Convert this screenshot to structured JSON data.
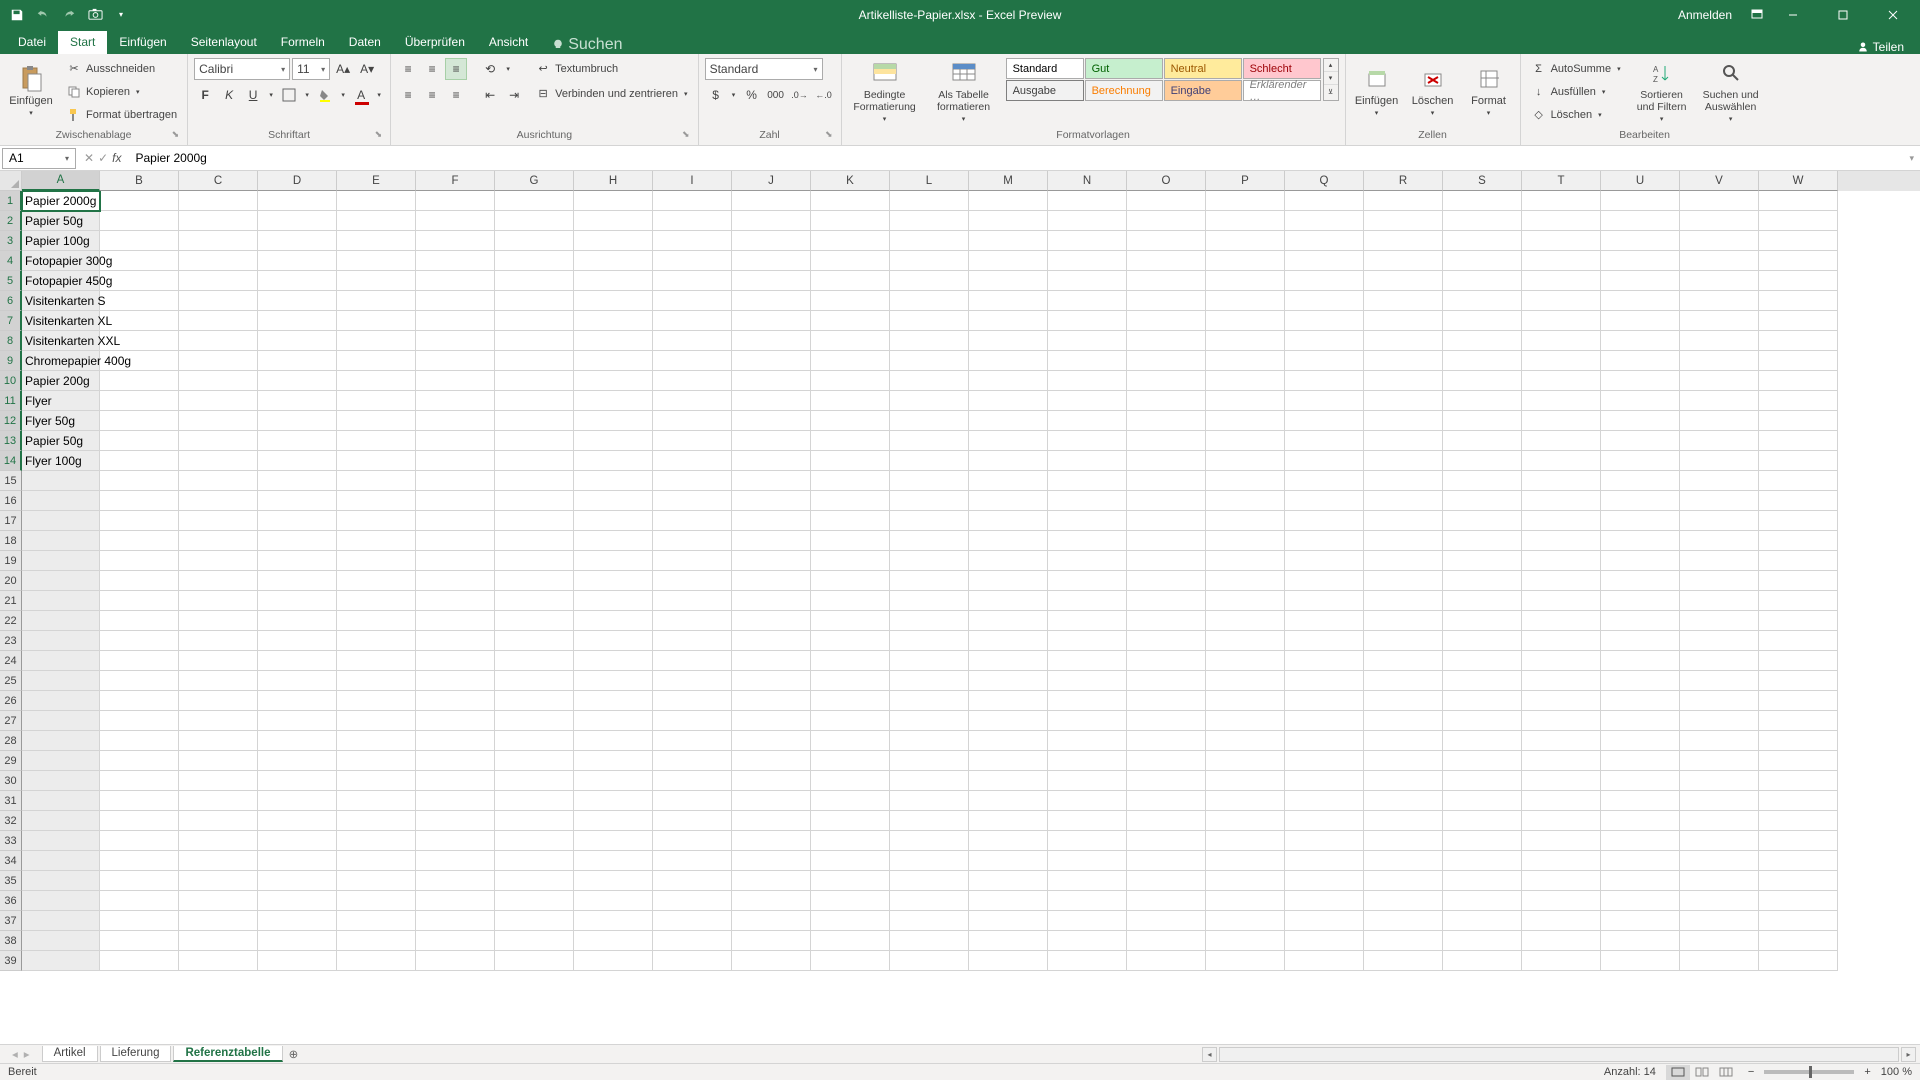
{
  "titlebar": {
    "filename": "Artikelliste-Papier.xlsx",
    "app_suffix": " - Excel Preview",
    "signin": "Anmelden"
  },
  "tabs": {
    "file": "Datei",
    "items": [
      "Start",
      "Einfügen",
      "Seitenlayout",
      "Formeln",
      "Daten",
      "Überprüfen",
      "Ansicht"
    ],
    "active_index": 0,
    "search": "Suchen",
    "share": "Teilen"
  },
  "ribbon": {
    "clipboard": {
      "paste": "Einfügen",
      "cut": "Ausschneiden",
      "copy": "Kopieren",
      "format_painter": "Format übertragen",
      "label": "Zwischenablage"
    },
    "font": {
      "name": "Calibri",
      "size": "11",
      "label": "Schriftart"
    },
    "alignment": {
      "wrap": "Textumbruch",
      "merge": "Verbinden und zentrieren",
      "label": "Ausrichtung"
    },
    "number": {
      "format": "Standard",
      "label": "Zahl"
    },
    "styles": {
      "cond": "Bedingte Formatierung",
      "astable": "Als Tabelle formatieren",
      "cells": [
        "Standard",
        "Gut",
        "Neutral",
        "Schlecht",
        "Ausgabe",
        "Berechnung",
        "Eingabe",
        "Erklärender …"
      ],
      "label": "Formatvorlagen"
    },
    "cells_group": {
      "insert": "Einfügen",
      "delete": "Löschen",
      "format": "Format",
      "label": "Zellen"
    },
    "editing": {
      "autosum": "AutoSumme",
      "fill": "Ausfüllen",
      "clear": "Löschen",
      "sort": "Sortieren und Filtern",
      "find": "Suchen und Auswählen",
      "label": "Bearbeiten"
    }
  },
  "formula_bar": {
    "cell_ref": "A1",
    "value": "Papier 2000g"
  },
  "grid": {
    "columns": [
      "A",
      "B",
      "C",
      "D",
      "E",
      "F",
      "G",
      "H",
      "I",
      "J",
      "K",
      "L",
      "M",
      "N",
      "O",
      "P",
      "Q",
      "R",
      "S",
      "T",
      "U",
      "V",
      "W"
    ],
    "col_widths": {
      "A": 78,
      "default": 79
    },
    "selected_col": "A",
    "active_row": 1,
    "data_rows": [
      "Papier 2000g",
      "Papier 50g",
      "Papier 100g",
      "Fotopapier 300g",
      "Fotopapier 450g",
      "Visitenkarten S",
      "Visitenkarten XL",
      "Visitenkarten XXL",
      "Chromepapier 400g",
      "Papier 200g",
      "Flyer",
      "Flyer 50g",
      "Papier 50g",
      "Flyer 100g"
    ],
    "row_count": 39
  },
  "sheets": {
    "tabs": [
      "Artikel",
      "Lieferung",
      "Referenztabelle"
    ],
    "active_index": 2
  },
  "statusbar": {
    "ready": "Bereit",
    "count_label": "Anzahl:",
    "count": "14",
    "zoom": "100 %"
  }
}
